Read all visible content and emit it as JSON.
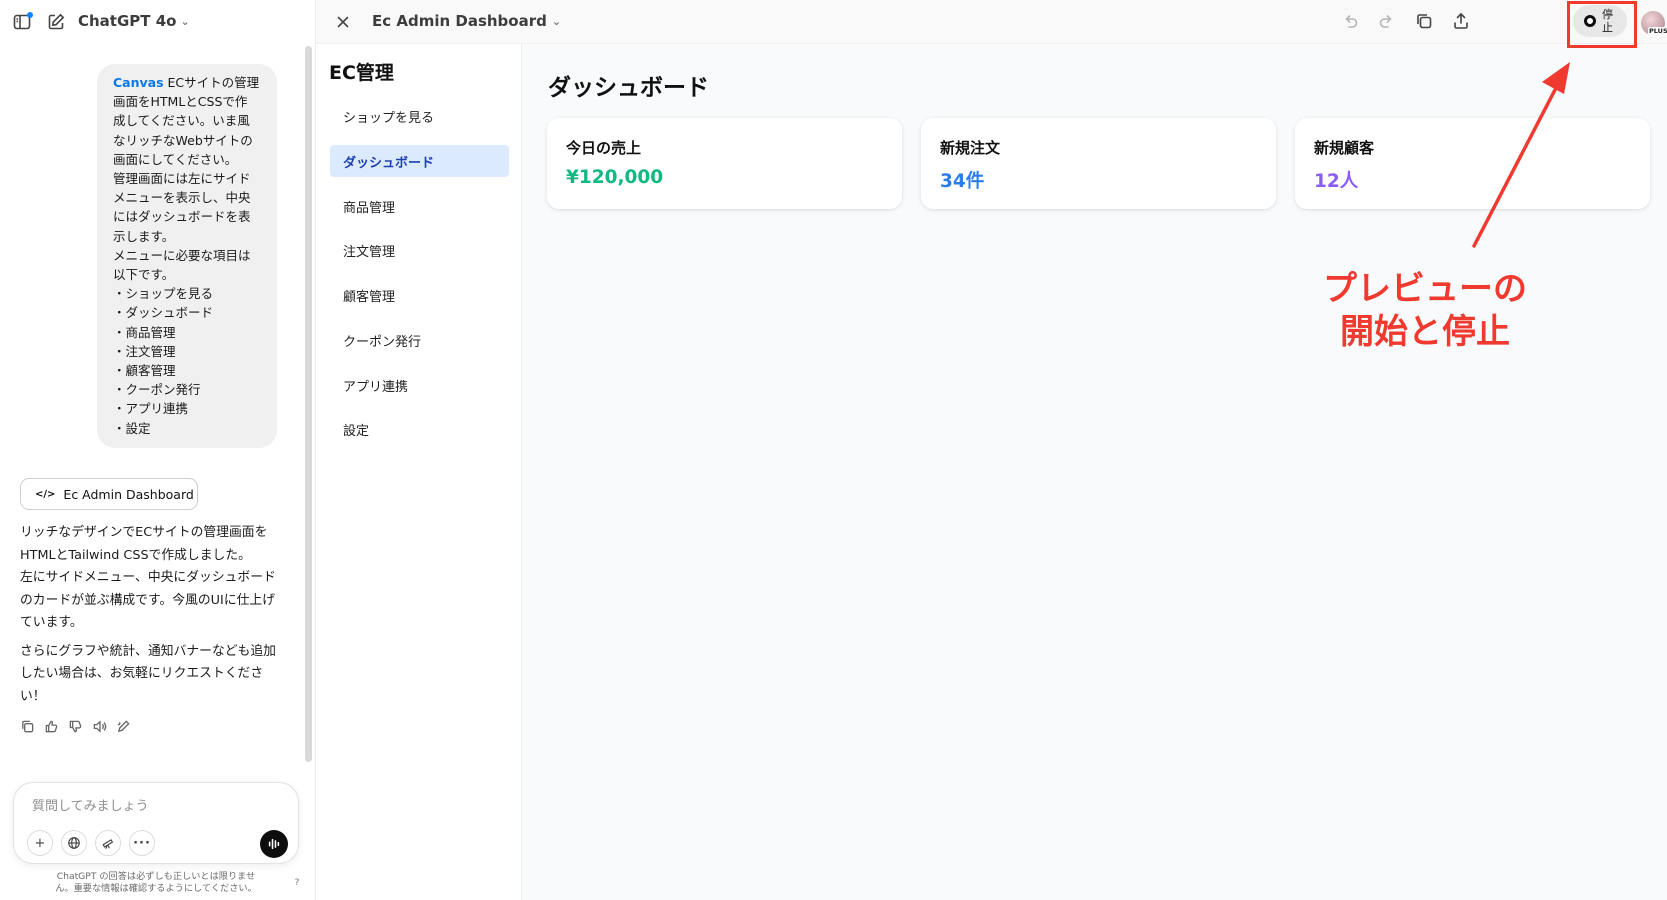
{
  "chat": {
    "model_name": "ChatGPT 4o",
    "user_message": {
      "canvas_tag": "Canvas",
      "first_line_rest": " ECサイトの管理",
      "lines": [
        "画面をHTMLとCSSで作",
        "成してください。いま風",
        "なリッチなWebサイトの",
        "画面にしてください。",
        "管理画面には左にサイド",
        "メニューを表示し、中央",
        "にはダッシュボードを表",
        "示します。",
        "メニューに必要な項目は",
        "以下です。",
        "・ショップを見る",
        "・ダッシュボード",
        "・商品管理",
        "・注文管理",
        "・顧客管理",
        "・クーポン発行",
        "・アプリ連携",
        "・設定"
      ]
    },
    "artifact_label": "Ec Admin Dashboard",
    "assistant_paragraphs": [
      [
        "リッチなデザインでECサイトの管理画面を",
        "HTMLとTailwind CSSで作成しました。",
        "左にサイドメニュー、中央にダッシュボード",
        "のカードが並ぶ構成です。今風のUIに仕上げ",
        "ています。"
      ],
      [
        "さらにグラフや統計、通知バナーなども追加",
        "したい場合は、お気軽にリクエストくださ",
        "い！"
      ]
    ],
    "composer_placeholder": "質問してみましょう",
    "disclaimer_lines": [
      "ChatGPT の回答は必ずしも正しいとは限りませ",
      "ん。重要な情報は確認するようにしてください。"
    ],
    "help_label": "?"
  },
  "canvas": {
    "title": "Ec Admin Dashboard",
    "preview_label": "停止",
    "plan_badge": "PLUS"
  },
  "admin": {
    "brand": "EC管理",
    "menu": [
      "ショップを見る",
      "ダッシュボード",
      "商品管理",
      "注文管理",
      "顧客管理",
      "クーポン発行",
      "アプリ連携",
      "設定"
    ],
    "active_index": 1,
    "page_title": "ダッシュボード",
    "cards": [
      {
        "label": "今日の売上",
        "value": "¥120,000",
        "color": "#10b981"
      },
      {
        "label": "新規注文",
        "value": "34件",
        "color": "#2b7de9"
      },
      {
        "label": "新規顧客",
        "value": "12人",
        "color": "#8b5cf6"
      }
    ]
  },
  "annotation": {
    "lines": [
      "プレビューの",
      "開始と停止"
    ],
    "color": "#f03a30"
  }
}
